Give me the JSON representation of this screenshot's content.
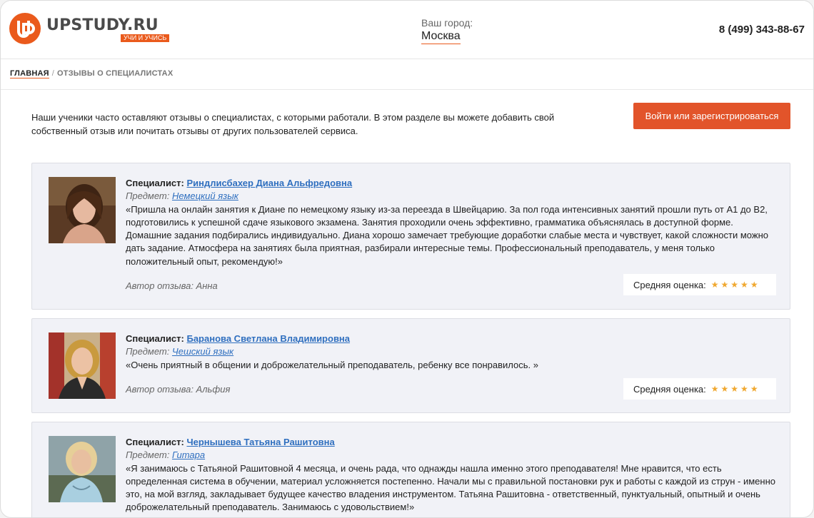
{
  "header": {
    "logo_name": "UPSTUDY.RU",
    "logo_slogan": "УЧИ И УЧИСЬ",
    "city_label": "Ваш город:",
    "city_value": "Москва",
    "phone": "8 (499) 343-88-67"
  },
  "breadcrumb": {
    "home": "ГЛАВНАЯ",
    "separator": "/",
    "current": "ОТЗЫВЫ О СПЕЦИАЛИСТАХ"
  },
  "intro": {
    "text": "Наши ученики часто оставляют отзывы о специалистах, с которыми работали. В этом разделе вы можете добавить свой собственный отзыв или почитать отзывы от других пользователей сервиса.",
    "login_button": "Войти или зарегистрироваться"
  },
  "labels": {
    "specialist": "Специалист:",
    "subject": "Предмет:",
    "rating": "Средняя оценка:"
  },
  "reviews": [
    {
      "specialist": "Риндлисбахер Диана Альфредовна",
      "subject": "Немецкий язык",
      "text": "«Пришла на онлайн занятия к Диане по немецкому языку из-за переезда в Швейцарию. За пол года интенсивных занятий прошли путь от А1 до В2, подготовились к успешной сдаче языкового экзамена. Занятия проходили очень эффективно, грамматика объяснялась в доступной форме. Домашние задания подбирались индивидуально. Диана хорошо замечает требующие доработки слабые места и чувствует, какой сложности можно дать задание. Атмосфера на занятиях была приятная, разбирали интересные темы. Профессиональный преподаватель, у меня только положительный опыт, рекомендую!»",
      "author": "Автор отзыва: Анна",
      "stars": "★★★★★",
      "rating_value": 5
    },
    {
      "specialist": "Баранова Светлана Владимировна",
      "subject": "Чешский язык",
      "text": "«Очень приятный в общении и доброжелательный преподаватель, ребенку все понравилось. »",
      "author": "Автор отзыва: Альфия",
      "stars": "★★★★★",
      "rating_value": 5
    },
    {
      "specialist": "Чернышева Татьяна Рашитовна",
      "subject": "Гитара",
      "text": "«Я занимаюсь с Татьяной Рашитовной 4 месяца, и очень рада, что однажды нашла именно этого преподавателя! Мне нравится, что есть определенная система в обучении, материал усложняется постепенно. Начали мы с правильной постановки рук и работы с каждой из струн - именно это, на мой взгляд, закладывает будущее качество владения инструментом. Татьяна Рашитовна - ответственный, пунктуальный, опытный и очень доброжелательный преподаватель. Занимаюсь с удовольствием!»"
    }
  ],
  "colors": {
    "accent": "#ea5a1c",
    "button": "#e2542a",
    "link": "#2f6fbf",
    "card_bg": "#f1f2f7",
    "star": "#f0a830"
  }
}
